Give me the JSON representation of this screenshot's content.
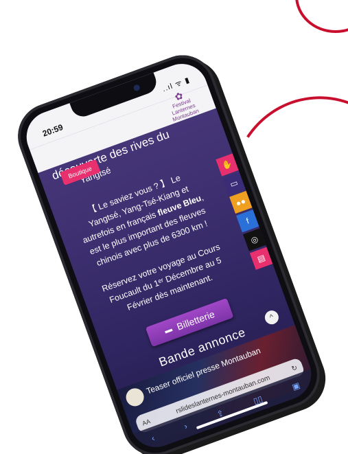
{
  "status": {
    "time": "20:59",
    "icons": "..ıl ᯤ ▮"
  },
  "logo": {
    "mark": "✿",
    "name": "Festival",
    "title": "Lanternes",
    "city": "Montauban"
  },
  "heading": {
    "line1": "découverte des rives du",
    "line2": "Yangtsé"
  },
  "boutique_label": "Boutique",
  "body": {
    "p1_a": "【 Le saviez vous ? 】 Le Yangtsé, Yang-Tsé-Kiang et autrefois en français ",
    "p1_b": "fleuve Bleu",
    "p1_c": ", est le plus important des fleuves chinois avec plus de 6300 km !",
    "p2": "Réservez votre voyage au Cours Foucault du 1ᵉʳ Décembre au 5 Février dès maintenant."
  },
  "billetterie_label": "Billetterie",
  "annonce_title": "Bande annonce",
  "video_title": "Teaser officiel presse Montauban",
  "url": "rslideslanternes-montauban.com",
  "url_aa": "AA",
  "colors": {
    "accent": "#e8306e",
    "button": "#8f3fb8",
    "annotation": "#c8102e"
  },
  "side_icons": [
    "handshake-icon",
    "ticket-icon",
    "group-icon",
    "facebook-icon",
    "instagram-icon",
    "shop-icon"
  ]
}
